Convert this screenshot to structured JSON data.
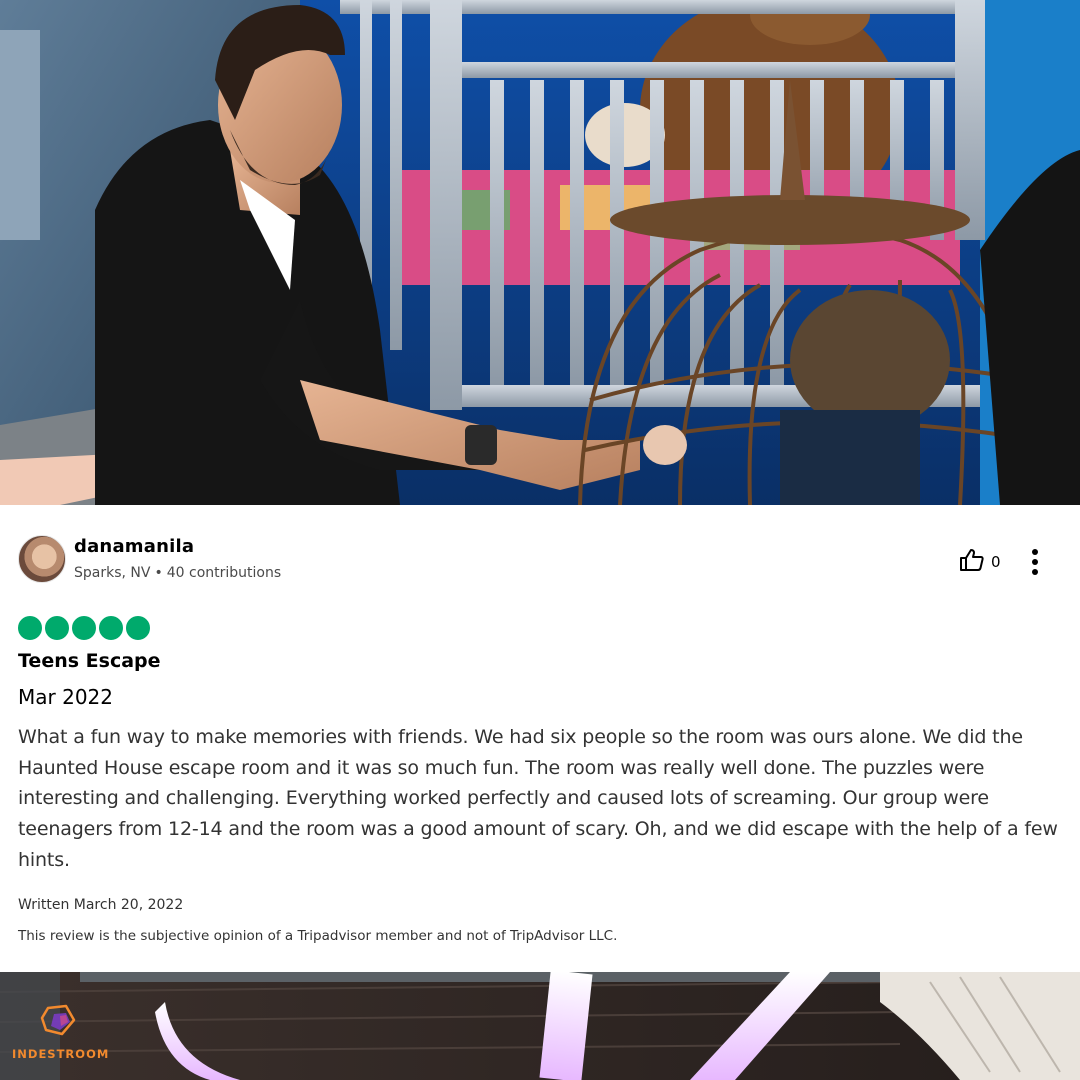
{
  "review": {
    "username": "danamanila",
    "location": "Sparks, NV",
    "contributions": "40 contributions",
    "separator": "•",
    "helpful_count": "0",
    "rating": 5,
    "title": "Teens Escape",
    "visit_date": "Mar 2022",
    "body": "What a fun way to make memories with friends. We had six people so the room was ours alone. We did the Haunted House escape room and it was so much fun. The room was really well done. The puzzles were interesting and challenging. Everything worked perfectly and caused lots of screaming. Our group were teenagers from 12-14 and the room was a good amount of scary. Oh, and we did escape with the help of a few hints.",
    "written_date": "Written March 20, 2022",
    "disclaimer": "This review is the subjective opinion of a Tripadvisor member and not of TripAdvisor LLC."
  },
  "brand": {
    "name": "INDESTROOM",
    "color": "#f28a2e"
  },
  "colors": {
    "rating_bubble": "#00aa6c"
  },
  "icons": {
    "helpful": "thumbs-up-icon",
    "more": "vertical-dots-icon"
  }
}
